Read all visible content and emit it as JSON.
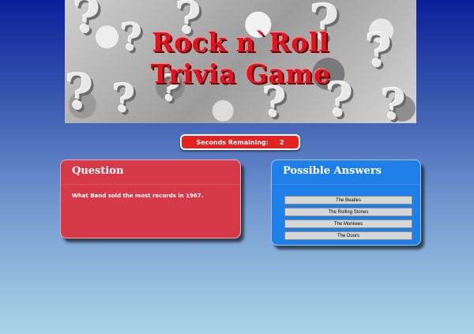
{
  "banner": {
    "title_line1": "Rock n`Roll",
    "title_line2": "Trivia Game"
  },
  "timer": {
    "label": "Seconds Remaining:",
    "value": "2"
  },
  "question_panel": {
    "heading": "Question",
    "text": "What Band sold the most records in 1967."
  },
  "answers_panel": {
    "heading": "Possible Answers",
    "options": [
      "The Beatles",
      "The Rolling Stones",
      "The Monkees",
      "The Doors"
    ]
  },
  "colors": {
    "accent_red": "#e32222",
    "question_bg": "#d63a48",
    "answers_bg": "#1f7fe8",
    "title_red": "#e01420"
  }
}
